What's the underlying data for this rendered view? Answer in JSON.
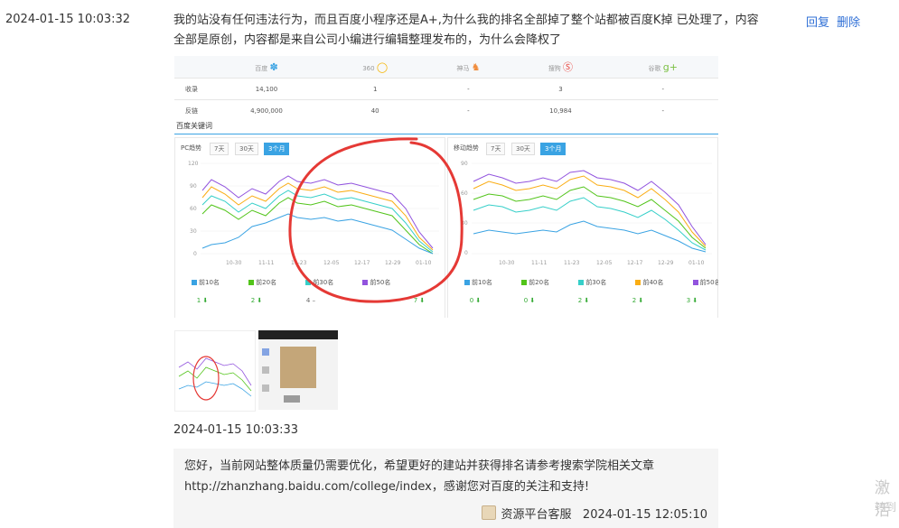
{
  "question": {
    "timestamp": "2024-01-15 10:03:32",
    "text": "我的站没有任何违法行为，而且百度小程序还是A+,为什么我的排名全部掉了整个站都被百度K掉   已处理了，内容全部是原创，内容都是来自公司小编进行编辑整理发布的，为什么会降权了",
    "actions": {
      "reply": "回复",
      "delete": "删除"
    }
  },
  "screenshot": {
    "engines": [
      "百度",
      "360",
      "神马",
      "搜狗",
      "谷歌"
    ],
    "rows": [
      {
        "label": "收录",
        "values": [
          "14,100",
          "1",
          "-",
          "3",
          "-"
        ]
      },
      {
        "label": "反链",
        "values": [
          "4,900,000",
          "40",
          "-",
          "10,984",
          "-"
        ]
      }
    ],
    "section_title": "百度关键词",
    "panels": [
      {
        "title": "PC趋势",
        "buttons": [
          "7天",
          "30天",
          "3个月"
        ],
        "active": "3个月",
        "x_ticks": [
          "10-30",
          "11-11",
          "11-23",
          "12-05",
          "12-17",
          "12-29",
          "01-10"
        ],
        "y_ticks": [
          "120",
          "90",
          "60",
          "30",
          "0"
        ],
        "counts": [
          "1 ⬇",
          "2 ⬇",
          "4 –",
          "",
          "7 ⬇"
        ]
      },
      {
        "title": "移动趋势",
        "buttons": [
          "7天",
          "30天",
          "3个月"
        ],
        "active": "3个月",
        "x_ticks": [
          "10-30",
          "11-11",
          "11-23",
          "12-05",
          "12-17",
          "12-29",
          "01-10"
        ],
        "y_ticks": [
          "90",
          "60",
          "30",
          "0"
        ],
        "counts": [
          "0 ⬇",
          "0 ⬇",
          "2 ⬇",
          "2 ⬇",
          "3 ⬇"
        ]
      }
    ],
    "legend": [
      "前10名",
      "前20名",
      "前30名",
      "前40名",
      "前50名"
    ],
    "legend_colors": [
      "#3aa3e3",
      "#52c41a",
      "#36cfc9",
      "#faad14",
      "#9254de"
    ]
  },
  "thumbnails": [
    "thumb-screenshot-1",
    "thumb-screenshot-2"
  ],
  "answer": {
    "timestamp": "2024-01-15 10:03:33",
    "text": "您好，当前网站整体质量仍需要优化，希望更好的建站并获得排名请参考搜索学院相关文章http://zhanzhang.baidu.com/college/index，感谢您对百度的关注和支持!",
    "author": "资源平台客服",
    "time": "2024-01-15 12:05:10"
  },
  "watermark": {
    "line1": "激活",
    "line2": "转到"
  }
}
